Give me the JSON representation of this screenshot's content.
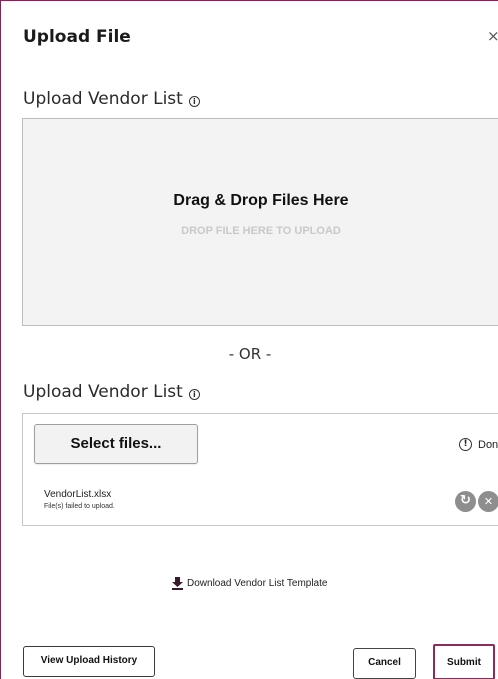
{
  "dialog": {
    "title": "Upload File",
    "close_symbol": "×"
  },
  "section_top": {
    "label": "Upload Vendor List",
    "info_icon": "i"
  },
  "dropzone": {
    "title": "Drag & Drop Files Here",
    "subtitle": "DROP FILE HERE TO UPLOAD"
  },
  "divider": {
    "text": "- OR -"
  },
  "section_bottom": {
    "label": "Upload Vendor List",
    "info_icon": "i"
  },
  "uploader": {
    "select_label": "Select files...",
    "status_icon": "!",
    "status_text": "Done",
    "file": {
      "name": "VendorList.xlsx",
      "message": "File(s) failed to upload.",
      "retry_icon": "↻",
      "remove_icon": "✕"
    }
  },
  "download": {
    "label": "Download Vendor List Template",
    "icon": "download-icon"
  },
  "footer": {
    "history_label": "View Upload History",
    "cancel_label": "Cancel",
    "submit_label": "Submit"
  },
  "colors": {
    "accent": "#8a2b5c",
    "dropzone_bg": "#f3f3f3",
    "icon_gray": "#8e8e8e"
  }
}
